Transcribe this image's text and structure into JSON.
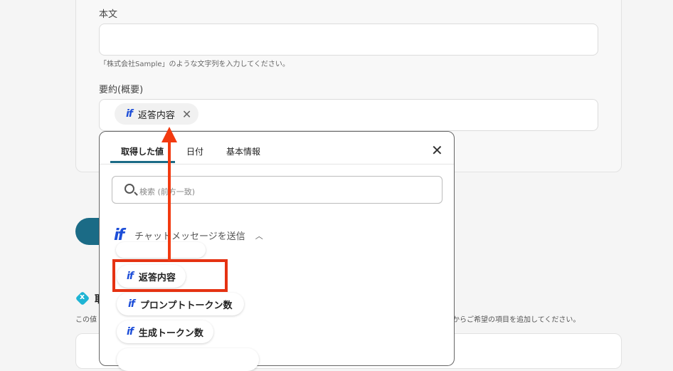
{
  "form": {
    "body_label": "本文",
    "body_hint": "「株式会社Sample」のような文字列を入力してください。",
    "summary_label": "要約(概要)",
    "summary_token": "返答内容",
    "token_icon": "if"
  },
  "popup": {
    "tabs": [
      "取得した値",
      "日付",
      "基本情報"
    ],
    "close_icon": "close-icon",
    "search_placeholder": "検索 (前方一致)",
    "group_title": "チャットメッセージを送信",
    "items": [
      {
        "label": "返答内容"
      },
      {
        "label": "プロンプトトークン数"
      },
      {
        "label": "生成トークン数"
      }
    ]
  },
  "section": {
    "title_initial": "取",
    "desc_left": "この値",
    "desc_right": "からご希望の項目を追加してください。"
  },
  "colors": {
    "accent": "#1b6b86",
    "if_blue": "#1d4ed8",
    "annotation_red": "#e53212"
  }
}
